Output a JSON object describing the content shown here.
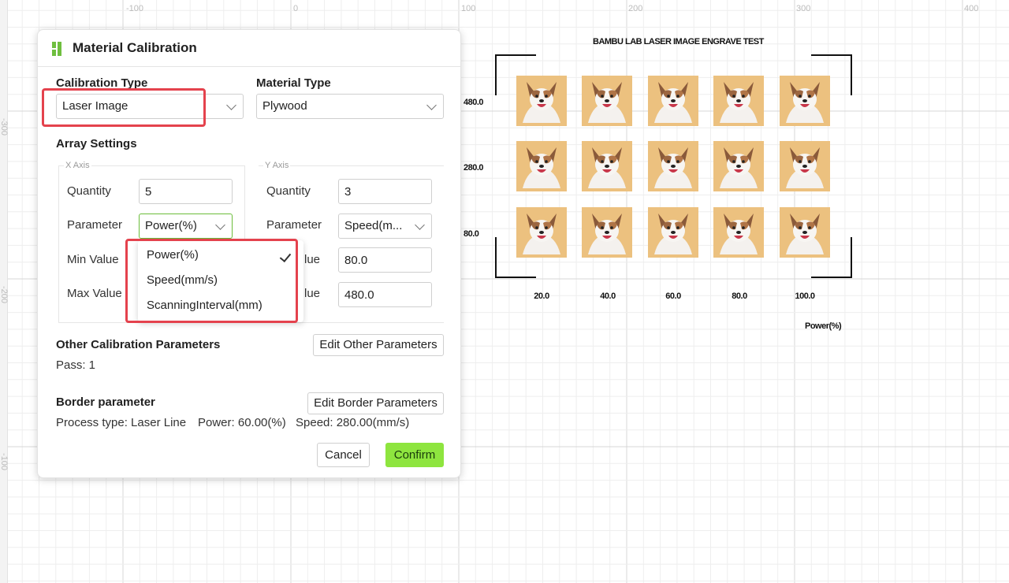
{
  "dialog": {
    "title": "Material Calibration",
    "calibration_type_label": "Calibration Type",
    "calibration_type_value": "Laser Image",
    "material_type_label": "Material Type",
    "material_type_value": "Plywood",
    "array_settings_label": "Array Settings",
    "x_axis": {
      "caption": "X Axis",
      "quantity_label": "Quantity",
      "quantity_value": "5",
      "parameter_label": "Parameter",
      "parameter_value": "Power(%)",
      "min_label": "Min Value",
      "max_label": "Max Value"
    },
    "y_axis": {
      "caption": "Y Axis",
      "quantity_label": "Quantity",
      "quantity_value": "3",
      "parameter_label": "Parameter",
      "parameter_value": "Speed(m...",
      "min_label_partial": "lue",
      "min_value": "80.0",
      "max_label_partial": "lue",
      "max_value": "480.0"
    },
    "parameter_dropdown": {
      "options": [
        "Power(%)",
        "Speed(mm/s)",
        "ScanningInterval(mm)"
      ],
      "selected": "Power(%)"
    },
    "other_params_label": "Other Calibration Parameters",
    "other_params_button": "Edit Other Parameters",
    "pass_text": "Pass: 1",
    "border_label": "Border parameter",
    "border_button": "Edit Border Parameters",
    "border_process": "Process type: Laser Line",
    "border_power": "Power: 60.00(%)",
    "border_speed": "Speed: 280.00(mm/s)",
    "cancel_button": "Cancel",
    "confirm_button": "Confirm"
  },
  "preview": {
    "title": "BAMBU LAB LASER IMAGE ENGRAVE TEST",
    "row_labels": [
      "480.0",
      "280.0",
      "80.0"
    ],
    "col_labels": [
      "20.0",
      "40.0",
      "60.0",
      "80.0",
      "100.0"
    ],
    "x_axis_name": "Power(%)",
    "tile_image": "dog-photo"
  },
  "ruler": {
    "top": [
      "-100",
      "0",
      "100",
      "200",
      "300",
      "400"
    ],
    "left": [
      "-300",
      "-200",
      "-100"
    ]
  },
  "colors": {
    "accent": "#8ee53f",
    "highlight": "#e4424d",
    "grid_minor": "#eeeeee",
    "grid_major": "#d7d7d7"
  }
}
